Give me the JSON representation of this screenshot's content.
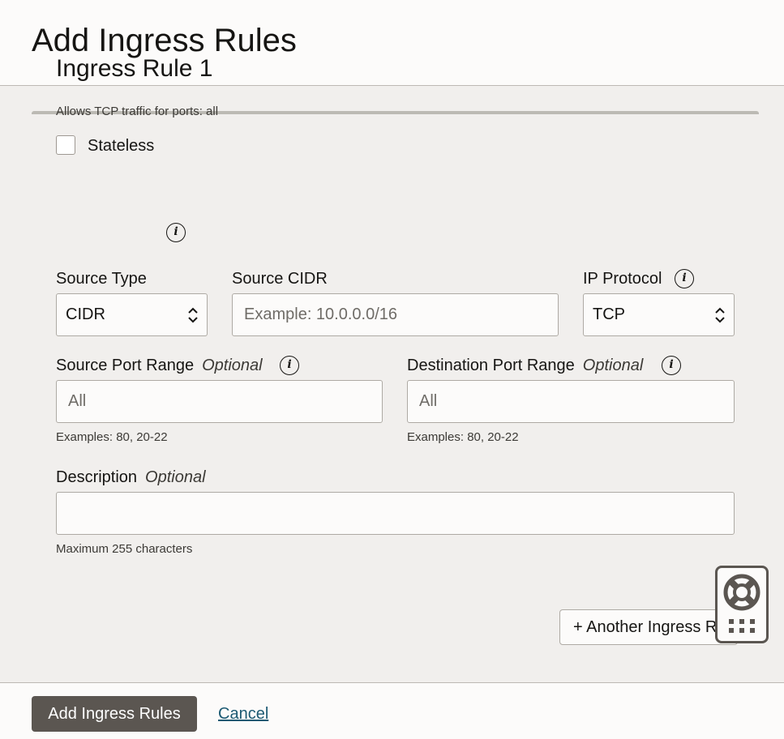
{
  "page": {
    "title": "Add Ingress Rules"
  },
  "rule": {
    "title": "Ingress Rule 1",
    "summary": "Allows TCP traffic for ports: all",
    "stateless_label": "Stateless",
    "source_type": {
      "label": "Source Type",
      "value": "CIDR"
    },
    "source_cidr": {
      "label": "Source CIDR",
      "placeholder": "Example: 10.0.0.0/16"
    },
    "ip_protocol": {
      "label": "IP Protocol",
      "value": "TCP"
    },
    "source_port": {
      "label": "Source Port Range",
      "optional": "Optional",
      "placeholder": "All",
      "help": "Examples: 80, 20-22"
    },
    "dest_port": {
      "label": "Destination Port Range",
      "optional": "Optional",
      "placeholder": "All",
      "help": "Examples: 80, 20-22"
    },
    "description": {
      "label": "Description",
      "optional": "Optional",
      "help": "Maximum 255 characters"
    }
  },
  "another_rule_label": "+ Another Ingress Rule",
  "footer": {
    "primary_label": "Add Ingress Rules",
    "cancel_label": "Cancel"
  },
  "icons": {
    "info": "info-icon",
    "help": "lifebuoy-icon",
    "apps": "grid-icon"
  },
  "colors": {
    "primary": "#5b5651",
    "link": "#1c5a73",
    "background": "#f1efed"
  }
}
